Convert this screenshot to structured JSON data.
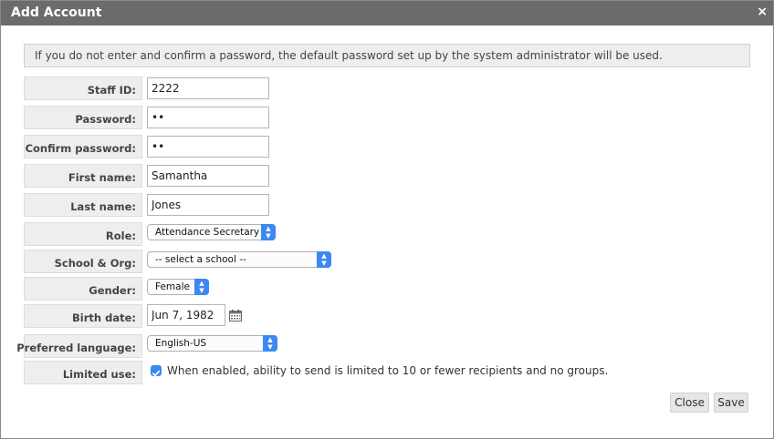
{
  "dialog": {
    "title": "Add Account",
    "close_glyph": "×"
  },
  "notice": "If you do not enter and confirm a password, the default password set up by the system administrator will be used.",
  "fields": {
    "staff_id": {
      "label": "Staff ID:",
      "value": "2222"
    },
    "password": {
      "label": "Password:",
      "value": "••"
    },
    "confirm_password": {
      "label": "Confirm password:",
      "value": "••"
    },
    "first_name": {
      "label": "First name:",
      "value": "Samantha"
    },
    "last_name": {
      "label": "Last name:",
      "value": "Jones"
    },
    "role": {
      "label": "Role:",
      "value": "Attendance Secretary"
    },
    "school": {
      "label": "School & Org:",
      "value": "-- select a school --"
    },
    "gender": {
      "label": "Gender:",
      "value": "Female"
    },
    "birth_date": {
      "label": "Birth date:",
      "value": "Jun 7, 1982"
    },
    "language": {
      "label": "Preferred language:",
      "value": "English-US"
    },
    "limited_use": {
      "label": "Limited use:",
      "checked": true,
      "text": "When enabled, ability to send is limited to 10 or fewer recipients and no groups."
    }
  },
  "buttons": {
    "close": "Close",
    "save": "Save"
  },
  "colors": {
    "titlebar": "#6b6b6b",
    "select_accent": "#3b88f2",
    "label_bg": "#eeeeee"
  },
  "icons": {
    "calendar": "calendar-icon",
    "check": "checkmark-icon",
    "close": "close-icon",
    "select_arrows": "up-down-arrows-icon"
  }
}
